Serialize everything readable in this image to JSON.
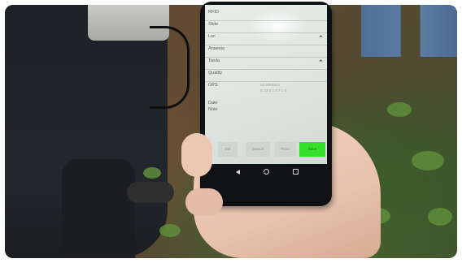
{
  "form": {
    "fields": [
      {
        "label": "RFID",
        "has_dropdown": false
      },
      {
        "label": "Slide",
        "has_dropdown": false
      },
      {
        "label": "Loc",
        "has_dropdown": true
      },
      {
        "label": "Anaesia",
        "has_dropdown": false
      },
      {
        "label": "Taxila",
        "has_dropdown": true
      },
      {
        "label": "Quality",
        "has_dropdown": false
      },
      {
        "label": "GPS",
        "has_dropdown": false
      },
      {
        "label": "Date",
        "has_dropdown": false
      },
      {
        "label": "Note",
        "has_dropdown": false
      }
    ],
    "gps_values": [
      "53.9093913",
      "N 33 0 2 8 9 1 0"
    ]
  },
  "buttons": [
    {
      "label": "Del",
      "primary": false
    },
    {
      "label": "Search",
      "primary": false
    },
    {
      "label": "Photo",
      "primary": false
    },
    {
      "label": "Save",
      "primary": true
    }
  ],
  "colors": {
    "save_button": "#35e02a",
    "screen_bg": "#e2e8e3",
    "phone_body": "#101114"
  },
  "nav_icons": [
    "back-icon",
    "home-icon",
    "recent-apps-icon"
  ]
}
